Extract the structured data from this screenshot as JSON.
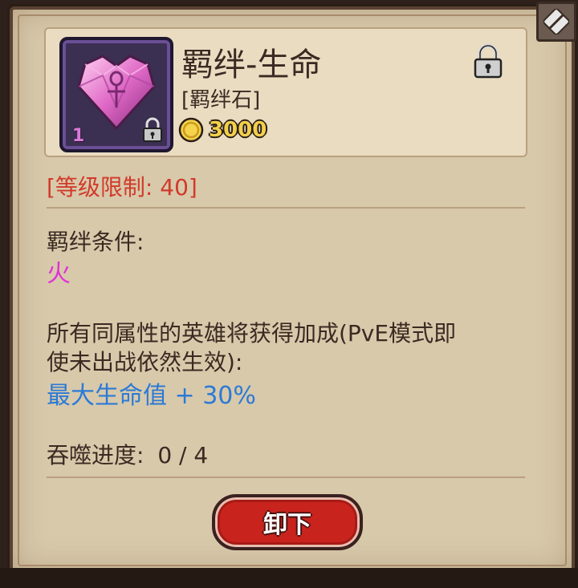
{
  "item": {
    "name": "羁绊-生命",
    "type": "[羁绊石]",
    "level": "1",
    "price": "3000",
    "icon": "pink-heart-gem-ankh-icon",
    "locked": true
  },
  "level_limit": "[等级限制: 40]",
  "bond": {
    "condition_label": "羁绊条件:",
    "element": "火"
  },
  "effect": {
    "description_line1": "所有同属性的英雄将获得加成(PvE模式即",
    "description_line2": "使未出战依然生效):",
    "bonus": "最大生命值 + 30%"
  },
  "devour": {
    "label": "吞噬进度:",
    "value": "0 / 4"
  },
  "buttons": {
    "unequip_label": "卸下"
  },
  "colors": {
    "level_limit": "#d13a2a",
    "element": "#e032d6",
    "bonus": "#2b7ad6",
    "price": "#f2d04a",
    "button": "#c8241d"
  }
}
